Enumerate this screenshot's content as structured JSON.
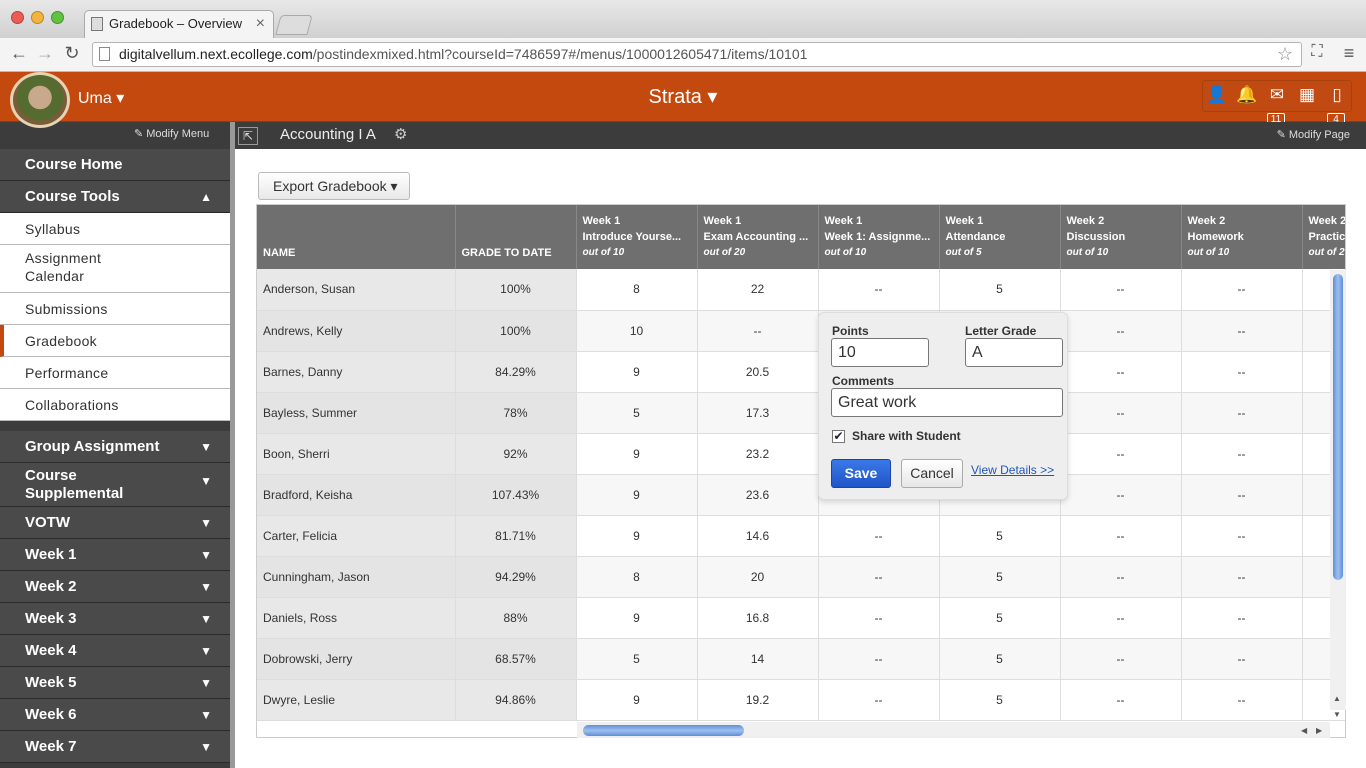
{
  "browser": {
    "tab_title": "Gradebook – Overview",
    "url_host": "digitalvellum.next.ecollege.com",
    "url_path": "/postindexmixed.html?courseId=7486597#/menus/1000012605471/items/10101"
  },
  "header": {
    "user_name": "Uma ▾",
    "brand": "Strata ▾",
    "mail_count": "11",
    "docs_count": "4"
  },
  "subheader": {
    "modify_menu": "✎ Modify Menu",
    "course_name": "Accounting I A",
    "modify_page": "✎ Modify Page"
  },
  "sidebar": {
    "course_home": "Course Home",
    "course_tools": "Course Tools",
    "tools": [
      "Syllabus",
      "Assignment Calendar",
      "Submissions",
      "Gradebook",
      "Performance",
      "Collaborations"
    ],
    "sections": [
      "Group Assignment",
      "Course Supplemental",
      "VOTW",
      "Week 1",
      "Week 2",
      "Week 3",
      "Week 4",
      "Week 5",
      "Week 6",
      "Week 7"
    ]
  },
  "toolbar": {
    "export_label": "Export Gradebook ▾"
  },
  "gradebook": {
    "name_header": "NAME",
    "grade_header": "GRADE TO DATE",
    "columns": [
      {
        "week": "Week 1",
        "title": "Introduce Yourse...",
        "out_of": "out of 10"
      },
      {
        "week": "Week 1",
        "title": "Exam Accounting ...",
        "out_of": "out of 20"
      },
      {
        "week": "Week 1",
        "title": "Week 1: Assignme...",
        "out_of": "out of 10"
      },
      {
        "week": "Week 1",
        "title": "Attendance",
        "out_of": "out of 5"
      },
      {
        "week": "Week 2",
        "title": "Discussion",
        "out_of": "out of 10"
      },
      {
        "week": "Week 2",
        "title": "Homework",
        "out_of": "out of 10"
      },
      {
        "week": "Week 2",
        "title": "Practic",
        "out_of": "out of 2"
      }
    ],
    "rows": [
      {
        "name": "Anderson, Susan",
        "grade": "100%",
        "scores": [
          "8",
          "22",
          "--",
          "5",
          "--",
          "--",
          ""
        ]
      },
      {
        "name": "Andrews, Kelly",
        "grade": "100%",
        "scores": [
          "10",
          "--",
          "",
          "",
          "--",
          "--",
          ""
        ]
      },
      {
        "name": "Barnes, Danny",
        "grade": "84.29%",
        "scores": [
          "9",
          "20.5",
          "",
          "",
          "--",
          "--",
          ""
        ]
      },
      {
        "name": "Bayless, Summer",
        "grade": "78%",
        "scores": [
          "5",
          "17.3",
          "",
          "",
          "--",
          "--",
          ""
        ]
      },
      {
        "name": "Boon, Sherri",
        "grade": "92%",
        "scores": [
          "9",
          "23.2",
          "",
          "",
          "--",
          "--",
          ""
        ]
      },
      {
        "name": "Bradford, Keisha",
        "grade": "107.43%",
        "scores": [
          "9",
          "23.6",
          "",
          "",
          "--",
          "--",
          ""
        ]
      },
      {
        "name": "Carter, Felicia",
        "grade": "81.71%",
        "scores": [
          "9",
          "14.6",
          "--",
          "5",
          "--",
          "--",
          ""
        ]
      },
      {
        "name": "Cunningham, Jason",
        "grade": "94.29%",
        "scores": [
          "8",
          "20",
          "--",
          "5",
          "--",
          "--",
          ""
        ]
      },
      {
        "name": "Daniels, Ross",
        "grade": "88%",
        "scores": [
          "9",
          "16.8",
          "--",
          "5",
          "--",
          "--",
          ""
        ]
      },
      {
        "name": "Dobrowski, Jerry",
        "grade": "68.57%",
        "scores": [
          "5",
          "14",
          "--",
          "5",
          "--",
          "--",
          ""
        ]
      },
      {
        "name": "Dwyre, Leslie",
        "grade": "94.86%",
        "scores": [
          "9",
          "19.2",
          "--",
          "5",
          "--",
          "--",
          ""
        ]
      }
    ]
  },
  "popover": {
    "points_label": "Points",
    "points_value": "10",
    "letter_label": "Letter Grade",
    "letter_value": "A",
    "comments_label": "Comments",
    "comments_value": "Great work",
    "share_label": "Share with Student",
    "share_checked": true,
    "save_label": "Save",
    "cancel_label": "Cancel",
    "details_label": "View Details >>"
  },
  "colors": {
    "brand_orange": "#c4490f",
    "nav_dark": "#3c3c3c",
    "save_blue": "#1f55c9"
  }
}
